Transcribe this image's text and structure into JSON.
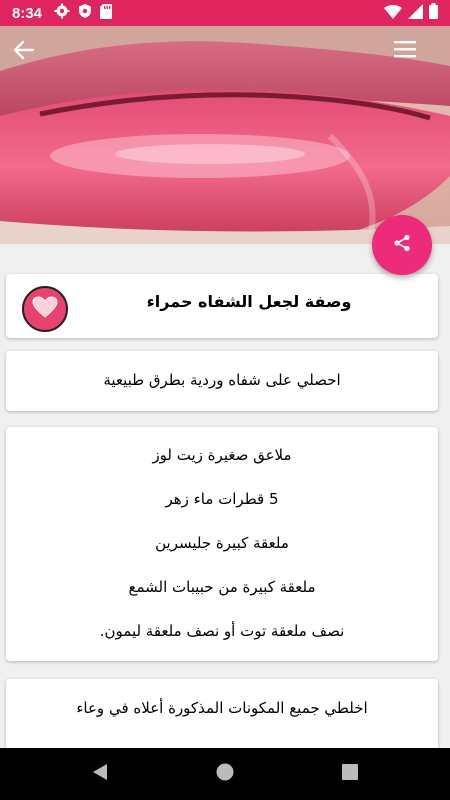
{
  "status_bar": {
    "time": "8:34",
    "left_icons": [
      "gear-icon",
      "shield-icon",
      "sd-card-icon"
    ],
    "right_icons": [
      "wifi-icon",
      "signal-icon",
      "battery-icon"
    ],
    "color": "#e0245e"
  },
  "app_bar": {
    "back_icon": "arrow-back-icon",
    "menu_icon": "hamburger-menu-icon"
  },
  "share_button": {
    "icon": "share-icon",
    "color": "#ee2a7b"
  },
  "recipe": {
    "title": "وصفة لجعل الشفاه حمراء",
    "subtitle": "احصلي على شفاه وردية بطرق طبيعية",
    "ingredients": [
      "ملاعق صغيرة زيت لوز",
      "5 قطرات ماء زهر",
      "ملعقة كبيرة جليسرين",
      "ملعقة كبيرة من حبيبات الشمع",
      "نصف ملعقة توت أو نصف ملعقة ليمون."
    ],
    "steps_text": "اخلطي جميع المكونات المذكورة أعلاه في وعاء"
  },
  "favorite_icon": "heart-icon",
  "nav_bar": {
    "back_icon": "nav-back-triangle-icon",
    "home_icon": "nav-home-circle-icon",
    "recents_icon": "nav-recents-square-icon"
  }
}
